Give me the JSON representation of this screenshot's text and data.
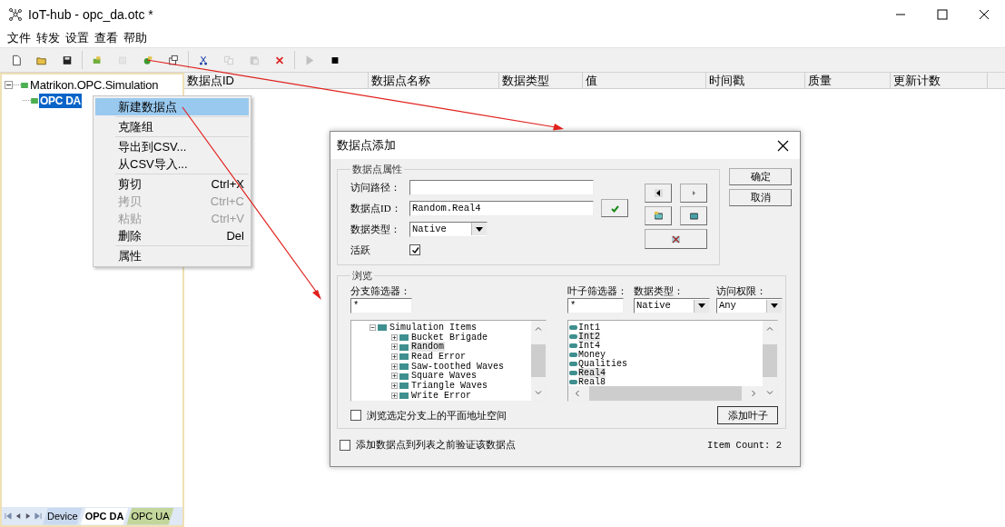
{
  "window": {
    "title": "IoT-hub - opc_da.otc *"
  },
  "menu_bar": [
    "文件",
    "转发",
    "设置",
    "查看",
    "帮助"
  ],
  "toolbar": [
    {
      "kind": "button",
      "disabled": false
    },
    {
      "kind": "button",
      "disabled": false
    },
    {
      "kind": "button",
      "disabled": false
    },
    {
      "kind": "separator"
    },
    {
      "kind": "button",
      "disabled": false
    },
    {
      "kind": "button",
      "disabled": true
    },
    {
      "kind": "button",
      "disabled": false
    },
    {
      "kind": "button",
      "disabled": false
    },
    {
      "kind": "separator"
    },
    {
      "kind": "button",
      "disabled": false
    },
    {
      "kind": "button",
      "disabled": true
    },
    {
      "kind": "button",
      "disabled": true
    },
    {
      "kind": "button",
      "disabled": false
    },
    {
      "kind": "separator"
    },
    {
      "kind": "button",
      "disabled": true
    },
    {
      "kind": "button",
      "disabled": false
    }
  ],
  "tree": [
    {
      "label": "Matrikon.OPC.Simulation",
      "expanded": true,
      "selected": false,
      "children": [
        {
          "label": "OPC DA",
          "selected": true
        }
      ]
    }
  ],
  "sheet_tabs": [
    {
      "label": "Device",
      "selected": false,
      "color": "#c9d9ef"
    },
    {
      "label": "OPC DA",
      "selected": true,
      "color": "#ffffff"
    },
    {
      "label": "OPC UA",
      "selected": false,
      "color": "#c3d69b"
    }
  ],
  "table": {
    "columns": [
      "数据点ID",
      "数据点名称",
      "数据类型",
      "值",
      "时间戳",
      "质量",
      "更新计数"
    ]
  },
  "context_menu": {
    "items": [
      {
        "kind": "item",
        "label": "新建数据点",
        "selected": true,
        "disabled": false
      },
      {
        "kind": "separator"
      },
      {
        "kind": "item",
        "label": "克隆组",
        "selected": false,
        "disabled": false
      },
      {
        "kind": "separator"
      },
      {
        "kind": "item",
        "label": "导出到CSV...",
        "selected": false,
        "disabled": false
      },
      {
        "kind": "item",
        "label": "从CSV导入...",
        "selected": false,
        "disabled": false
      },
      {
        "kind": "separator"
      },
      {
        "kind": "item",
        "label": "剪切",
        "shortcut": "Ctrl+X",
        "selected": false,
        "disabled": false
      },
      {
        "kind": "item",
        "label": "拷贝",
        "shortcut": "Ctrl+C",
        "selected": false,
        "disabled": true
      },
      {
        "kind": "item",
        "label": "粘贴",
        "shortcut": "Ctrl+V",
        "selected": false,
        "disabled": true
      },
      {
        "kind": "item",
        "label": "删除",
        "shortcut": "Del",
        "selected": false,
        "disabled": false
      },
      {
        "kind": "separator"
      },
      {
        "kind": "item",
        "label": "属性",
        "selected": false,
        "disabled": false
      }
    ]
  },
  "dialog": {
    "title": "数据点添加",
    "properties": {
      "legend": "数据点属性",
      "fields": [
        {
          "kind": "text",
          "label": "访问路径："
        },
        {
          "kind": "validated",
          "label": "数据点ID：",
          "value": "Random.Real4"
        },
        {
          "kind": "select",
          "label": "数据类型：",
          "value": "Native"
        },
        {
          "kind": "checkbox",
          "label": "活跃",
          "checked": true
        }
      ]
    },
    "buttons": [
      "确定",
      "取消"
    ],
    "browse": {
      "legend": "浏览",
      "branch_filter": {
        "label": "分支筛选器：",
        "value": "*"
      },
      "branch_tree": [
        {
          "label": "Simulation Items",
          "expanded": true,
          "selected": false,
          "children": [
            {
              "label": "Bucket Brigade",
              "expanded": false,
              "selected": false
            },
            {
              "label": "Random",
              "expanded": false,
              "selected": true
            },
            {
              "label": "Read Error",
              "expanded": false,
              "selected": false
            },
            {
              "label": "Saw-toothed Waves",
              "expanded": false,
              "selected": false
            },
            {
              "label": "Square Waves",
              "expanded": false,
              "selected": false
            },
            {
              "label": "Triangle Waves",
              "expanded": false,
              "selected": false
            },
            {
              "label": "Write Error",
              "expanded": false,
              "selected": false
            }
          ]
        }
      ],
      "leaf_filter": {
        "label": "叶子筛选器：",
        "value": "*"
      },
      "data_type": {
        "label": "数据类型：",
        "value": "Native"
      },
      "access": {
        "label": "访问权限：",
        "value": "Any"
      },
      "leaves": [
        {
          "label": "Int1",
          "selected": false
        },
        {
          "label": "Int2",
          "selected": true
        },
        {
          "label": "Int4",
          "selected": false
        },
        {
          "label": "Money",
          "selected": false
        },
        {
          "label": "Qualities",
          "selected": false
        },
        {
          "label": "Real4",
          "selected": true
        },
        {
          "label": "Real8",
          "selected": false
        }
      ],
      "flat_checkbox": {
        "label": "浏览选定分支上的平面地址空间",
        "checked": false
      },
      "add_leaf_button": "添加叶子"
    },
    "validate_checkbox": {
      "label": "添加数据点到列表之前验证该数据点",
      "checked": false
    },
    "item_count": "Item Count: 2"
  }
}
